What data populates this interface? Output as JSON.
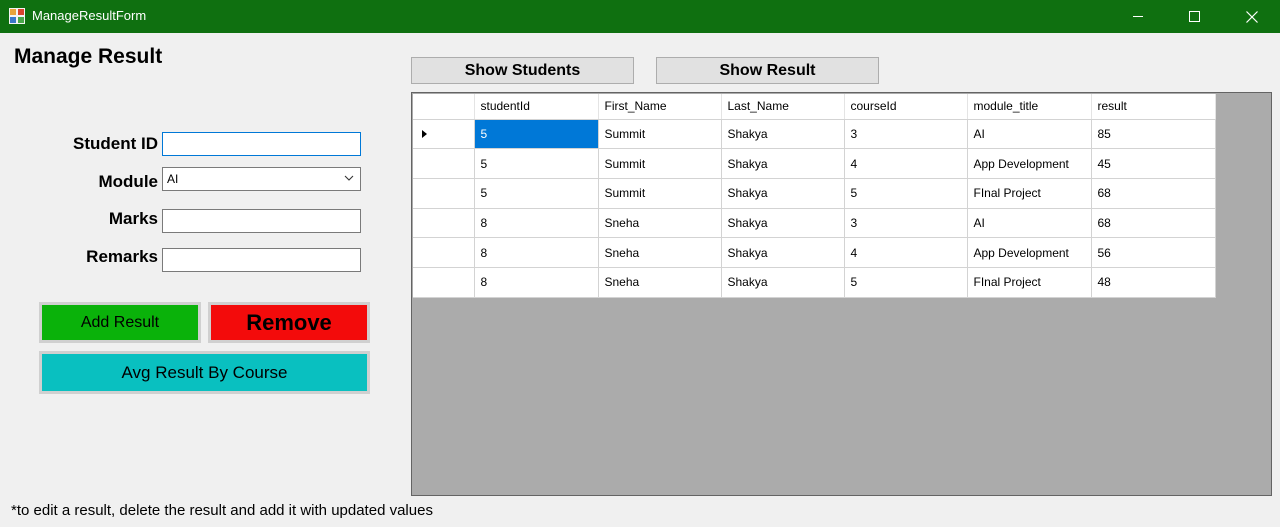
{
  "window": {
    "title": "ManageResultForm",
    "titlebar_color": "#0f7010",
    "controls": [
      "minimize-icon",
      "maximize-icon",
      "close-icon"
    ]
  },
  "form": {
    "heading": "Manage Result",
    "student_id_label": "Student ID",
    "student_id_value": "",
    "module_label": "Module",
    "module_value": "AI",
    "marks_label": "Marks",
    "marks_value": "",
    "remarks_label": "Remarks",
    "remarks_value": ""
  },
  "actions": {
    "add_label": "Add Result",
    "remove_label": "Remove",
    "avg_label": "Avg Result By Course",
    "add_color": "#0ab20a",
    "remove_color": "#f30b0b",
    "avg_color": "#09c0c0"
  },
  "toolbar": {
    "show_students_label": "Show Students",
    "show_result_label": "Show Result"
  },
  "grid": {
    "columns": [
      "studentId",
      "First_Name",
      "Last_Name",
      "courseId",
      "module_title",
      "result"
    ],
    "rows": [
      [
        "5",
        "Summit",
        "Shakya",
        "3",
        "AI",
        "85"
      ],
      [
        "5",
        "Summit",
        "Shakya",
        "4",
        "App Development",
        "45"
      ],
      [
        "5",
        "Summit",
        "Shakya",
        "5",
        "FInal Project",
        "68"
      ],
      [
        "8",
        "Sneha",
        "Shakya",
        "3",
        "AI",
        "68"
      ],
      [
        "8",
        "Sneha",
        "Shakya",
        "4",
        "App Development",
        "56"
      ],
      [
        "8",
        "Sneha",
        "Shakya",
        "5",
        "FInal Project",
        "48"
      ]
    ],
    "current_row": 0,
    "selected_color": "#0078d7"
  },
  "footnote": "*to edit a result, delete the result and add it with updated values"
}
